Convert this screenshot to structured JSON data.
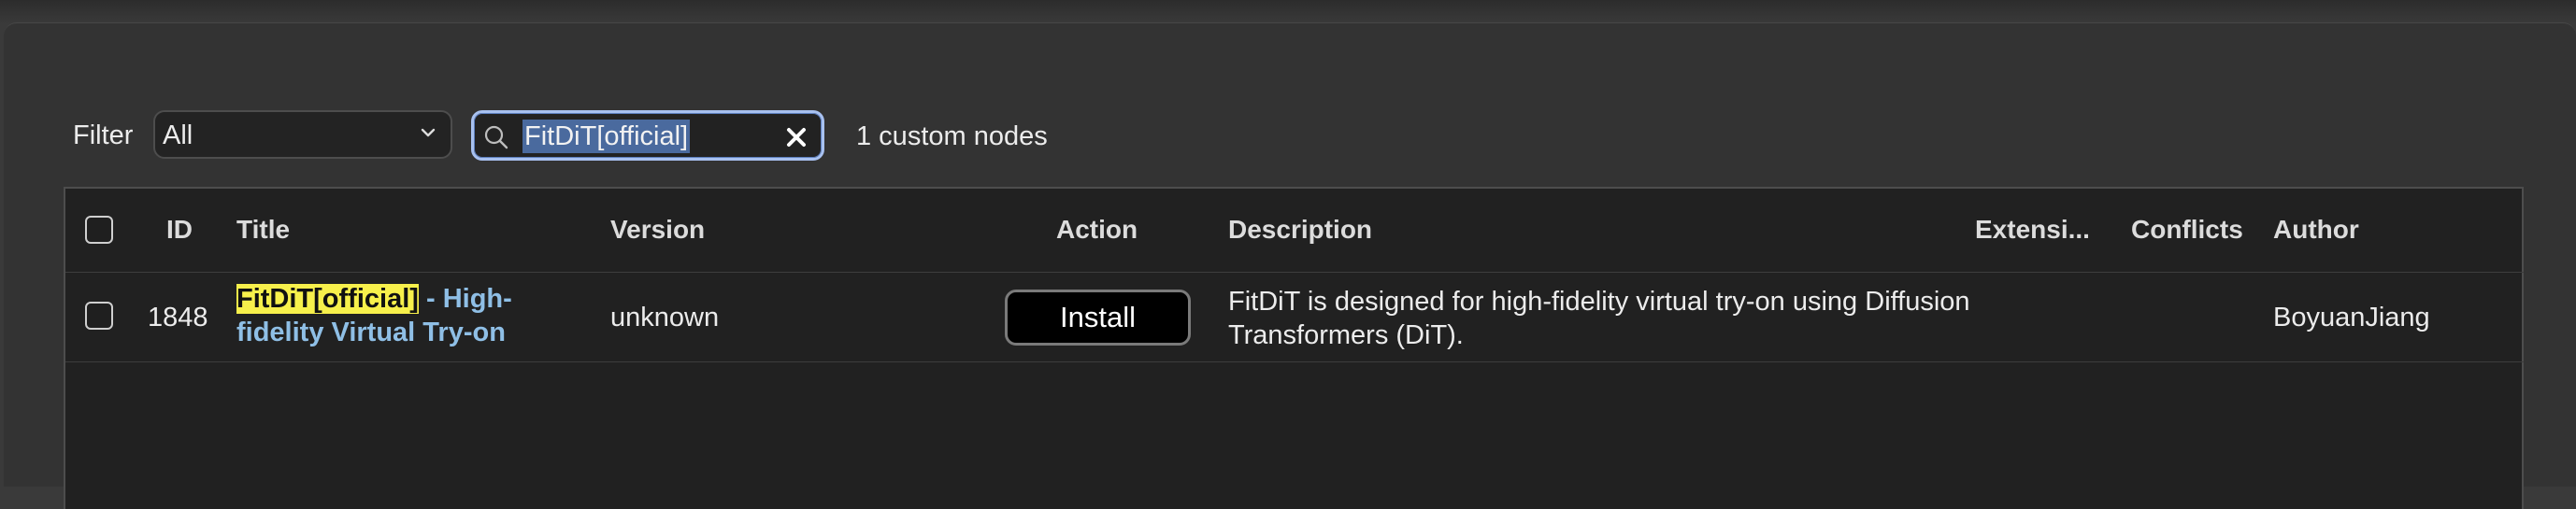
{
  "toolbar": {
    "filter_label": "Filter",
    "filter_select_value": "All",
    "search_value": "FitDiT[official]",
    "result_count": "1 custom nodes"
  },
  "table": {
    "columns": [
      "ID",
      "Title",
      "Version",
      "Action",
      "Description",
      "Extensi...",
      "Conflicts",
      "Author"
    ],
    "rows": [
      {
        "id": "1848",
        "title_highlight": "FitDiT[official]",
        "title_rest": " - High-fidelity Virtual Try-on",
        "version": "unknown",
        "action_label": "Install",
        "description": "FitDiT is designed for high-fidelity virtual try-on using Diffusion Transformers (DiT).",
        "extensions": "",
        "conflicts": "",
        "author": "BoyuanJiang"
      }
    ]
  },
  "colors": {
    "background": "#333333",
    "table_bg": "#212121",
    "search_focus": "#a8c1f0",
    "highlight": "#f7f04b",
    "title_link": "#8fbfe6"
  },
  "icons": [
    "chevron-down-icon",
    "search-icon",
    "clear-icon"
  ]
}
